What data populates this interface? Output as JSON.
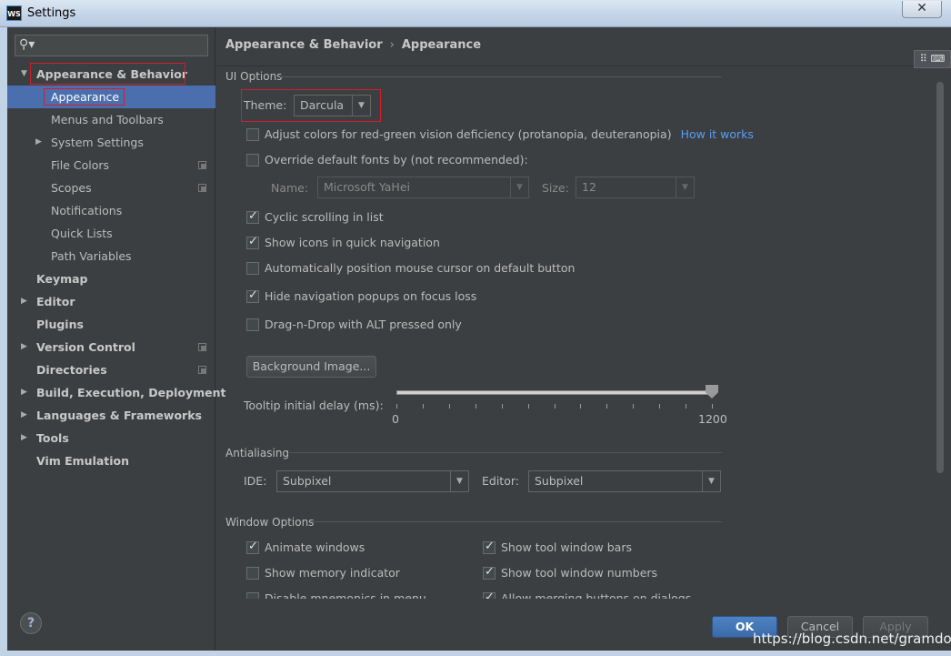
{
  "window": {
    "title": "Settings",
    "app_icon": "WS",
    "close_glyph": "✕"
  },
  "sidebar": {
    "search_placeholder": "",
    "items": [
      {
        "label": "Appearance & Behavior",
        "level": 0,
        "bold": true,
        "arrow": "▼",
        "selected": false
      },
      {
        "label": "Appearance",
        "level": 1,
        "bold": false,
        "arrow": "",
        "selected": true
      },
      {
        "label": "Menus and Toolbars",
        "level": 1,
        "bold": false,
        "arrow": "",
        "selected": false
      },
      {
        "label": "System Settings",
        "level": 1,
        "bold": false,
        "arrow": "▶",
        "selected": false
      },
      {
        "label": "File Colors",
        "level": 1,
        "bold": false,
        "arrow": "",
        "selected": false,
        "copy": true
      },
      {
        "label": "Scopes",
        "level": 1,
        "bold": false,
        "arrow": "",
        "selected": false,
        "copy": true
      },
      {
        "label": "Notifications",
        "level": 1,
        "bold": false,
        "arrow": "",
        "selected": false
      },
      {
        "label": "Quick Lists",
        "level": 1,
        "bold": false,
        "arrow": "",
        "selected": false
      },
      {
        "label": "Path Variables",
        "level": 1,
        "bold": false,
        "arrow": "",
        "selected": false
      },
      {
        "label": "Keymap",
        "level": 0,
        "bold": true,
        "arrow": "",
        "selected": false
      },
      {
        "label": "Editor",
        "level": 0,
        "bold": true,
        "arrow": "▶",
        "selected": false
      },
      {
        "label": "Plugins",
        "level": 0,
        "bold": true,
        "arrow": "",
        "selected": false
      },
      {
        "label": "Version Control",
        "level": 0,
        "bold": true,
        "arrow": "▶",
        "selected": false,
        "copy": true
      },
      {
        "label": "Directories",
        "level": 0,
        "bold": true,
        "arrow": "",
        "selected": false,
        "copy": true
      },
      {
        "label": "Build, Execution, Deployment",
        "level": 0,
        "bold": true,
        "arrow": "▶",
        "selected": false
      },
      {
        "label": "Languages & Frameworks",
        "level": 0,
        "bold": true,
        "arrow": "▶",
        "selected": false
      },
      {
        "label": "Tools",
        "level": 0,
        "bold": true,
        "arrow": "▶",
        "selected": false
      },
      {
        "label": "Vim Emulation",
        "level": 0,
        "bold": true,
        "arrow": "",
        "selected": false
      }
    ],
    "help_label": "?"
  },
  "main": {
    "breadcrumb": {
      "parent": "Appearance & Behavior",
      "separator": "›",
      "current": "Appearance"
    },
    "ui_options": {
      "title": "UI Options",
      "theme_label": "Theme:",
      "theme_value": "Darcula",
      "adjust_colors": {
        "label": "Adjust colors for red-green vision deficiency (protanopia, deuteranopia)",
        "checked": false,
        "link": "How it works"
      },
      "override_fonts": {
        "label": "Override default fonts by (not recommended):",
        "checked": false
      },
      "font_name_label": "Name:",
      "font_name_value": "Microsoft YaHei",
      "font_size_label": "Size:",
      "font_size_value": "12",
      "checkboxes": [
        {
          "label": "Cyclic scrolling in list",
          "checked": true
        },
        {
          "label": "Show icons in quick navigation",
          "checked": true
        },
        {
          "label": "Automatically position mouse cursor on default button",
          "checked": false
        },
        {
          "label": "Hide navigation popups on focus loss",
          "checked": true
        },
        {
          "label": "Drag-n-Drop with ALT pressed only",
          "checked": false
        }
      ],
      "background_button": "Background Image...",
      "tooltip_label": "Tooltip initial delay (ms):",
      "tooltip_min": "0",
      "tooltip_max": "1200",
      "tooltip_value": 1200
    },
    "antialiasing": {
      "title": "Antialiasing",
      "ide_label": "IDE:",
      "ide_value": "Subpixel",
      "editor_label": "Editor:",
      "editor_value": "Subpixel"
    },
    "window_options": {
      "title": "Window Options",
      "left": [
        {
          "label": "Animate windows",
          "checked": true
        },
        {
          "label": "Show memory indicator",
          "checked": false
        },
        {
          "label": "Disable mnemonics in menu",
          "checked": false
        }
      ],
      "right": [
        {
          "label": "Show tool window bars",
          "checked": true
        },
        {
          "label": "Show tool window numbers",
          "checked": true
        },
        {
          "label": "Allow merging buttons on dialogs",
          "checked": true
        }
      ]
    }
  },
  "footer": {
    "ok": "OK",
    "cancel": "Cancel",
    "apply": "Apply"
  },
  "watermark": "https://blog.csdn.net/gramdog",
  "colors": {
    "selection": "#4b6eaf",
    "link": "#589df6",
    "highlight_box": "#d0202a",
    "background": "#3c3f41"
  }
}
